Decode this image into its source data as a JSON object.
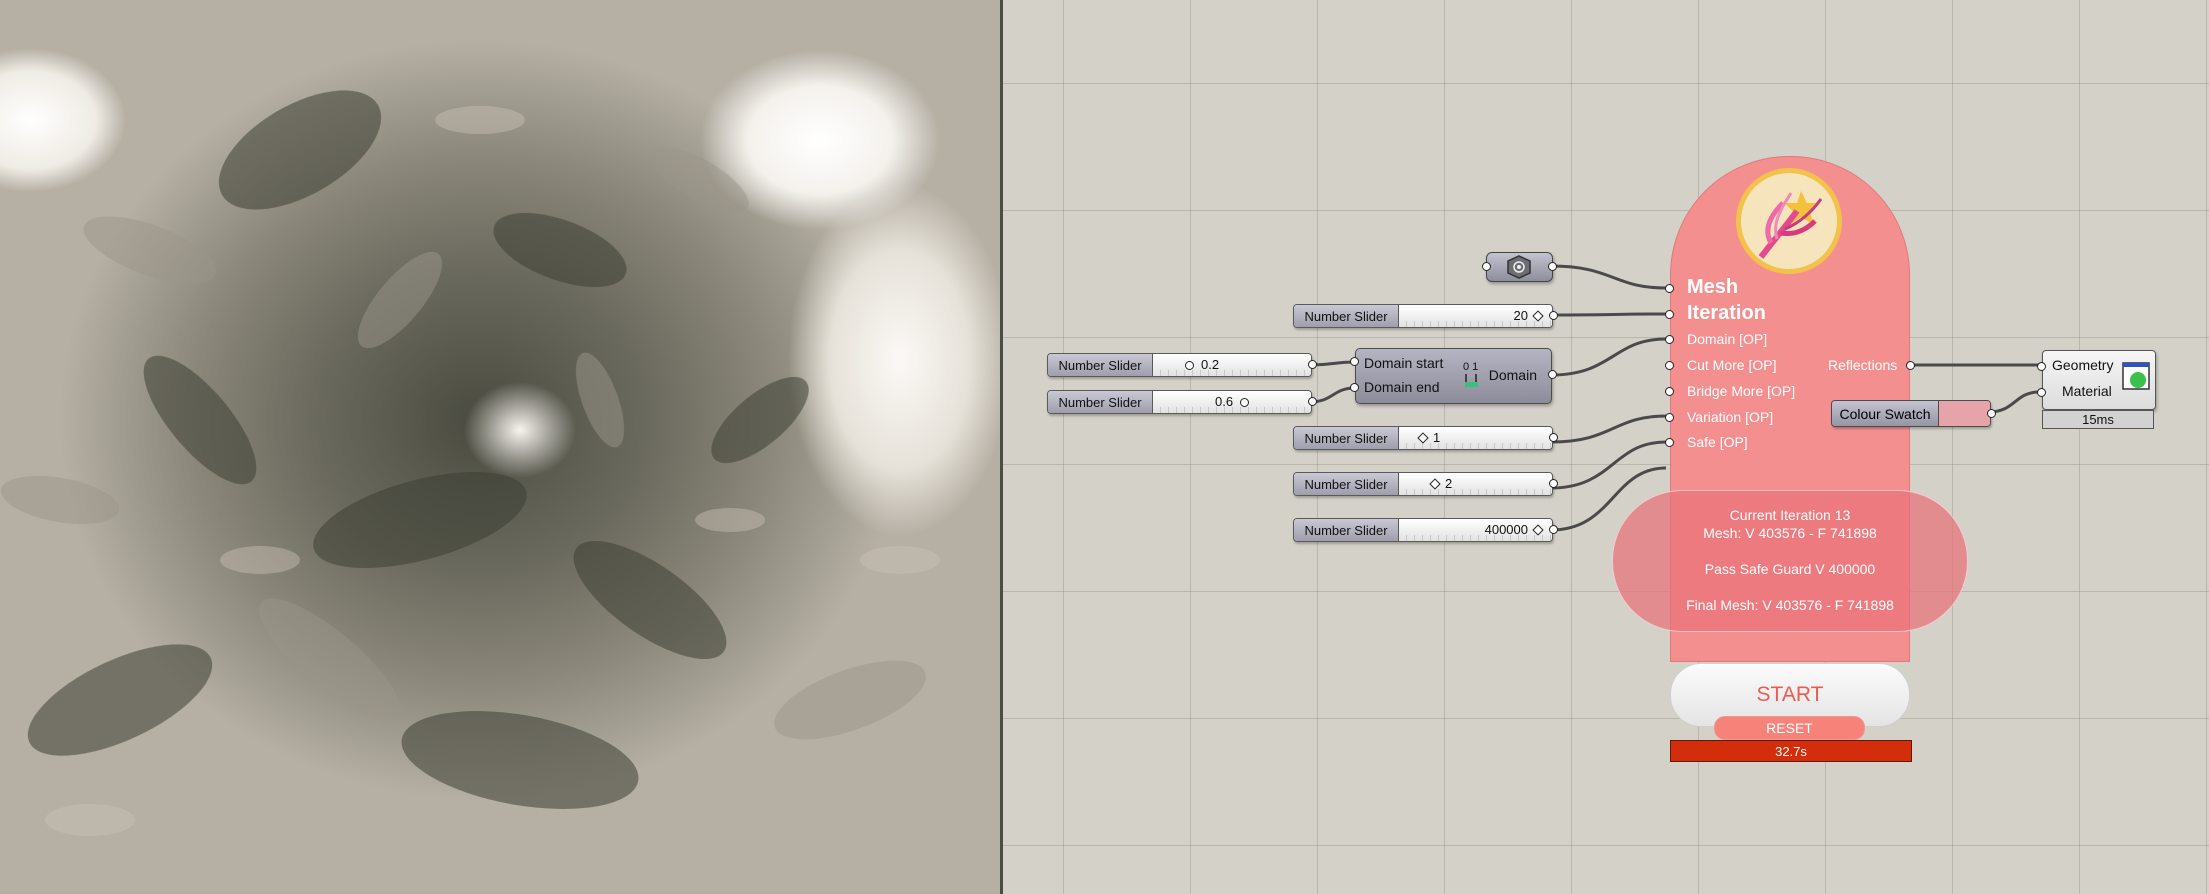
{
  "sliders": [
    {
      "label": "Number Slider",
      "value": "20"
    },
    {
      "label": "Number Slider",
      "value": "0.2"
    },
    {
      "label": "Number Slider",
      "value": "0.6"
    },
    {
      "label": "Number Slider",
      "value": "1"
    },
    {
      "label": "Number Slider",
      "value": "2"
    },
    {
      "label": "Number Slider",
      "value": "400000"
    }
  ],
  "domain_component": {
    "input_start": "Domain start",
    "input_end": "Domain end",
    "output": "Domain",
    "icon_text": "0 1"
  },
  "main_component": {
    "inputs": [
      "Mesh",
      "Iteration",
      "Domain [OP]",
      "Cut More [OP]",
      "Bridge More [OP]",
      "Variation [OP]",
      "Safe [OP]"
    ],
    "output": "Reflections",
    "status": {
      "line1": "Current Iteration 13",
      "line2": "Mesh: V 403576 - F 741898",
      "line3": "Pass Safe Guard V 400000",
      "line4": "Final Mesh: V 403576 - F 741898"
    },
    "start_label": "START",
    "reset_label": "RESET",
    "elapsed": "32.7s"
  },
  "colour_swatch": {
    "label": "Colour Swatch",
    "color": "#e6a4aa"
  },
  "preview_component": {
    "input1": "Geometry",
    "input2": "Material",
    "time": "15ms"
  },
  "icons": {
    "mesh_param": "hexagon-mesh-icon",
    "logo": "fractal-flower-logo",
    "preview": "custom-preview-icon"
  },
  "colors": {
    "main_component": "#f48f90",
    "start_text": "#ef5a4f",
    "elapsed_bar": "#d42d0c"
  }
}
